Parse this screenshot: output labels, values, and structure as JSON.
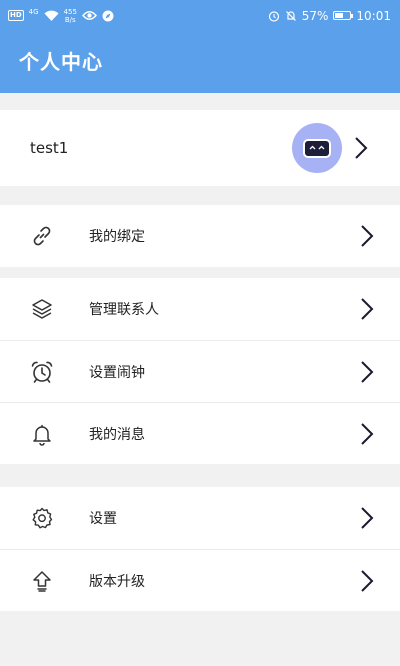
{
  "status_bar": {
    "hd": "HD",
    "signal": "4G",
    "speed_top": "455",
    "speed_bottom": "B/s",
    "battery_percent": "57%",
    "battery_level": 0.57,
    "time": "10:01"
  },
  "header": {
    "title": "个人中心"
  },
  "profile": {
    "username": "test1"
  },
  "menu": {
    "bind": "我的绑定",
    "contacts": "管理联系人",
    "alarm": "设置闹钟",
    "messages": "我的消息",
    "settings": "设置",
    "upgrade": "版本升级"
  },
  "colors": {
    "header": "#5aa0ea",
    "avatar": "#a7b2f4",
    "background": "#f1f1f1"
  }
}
